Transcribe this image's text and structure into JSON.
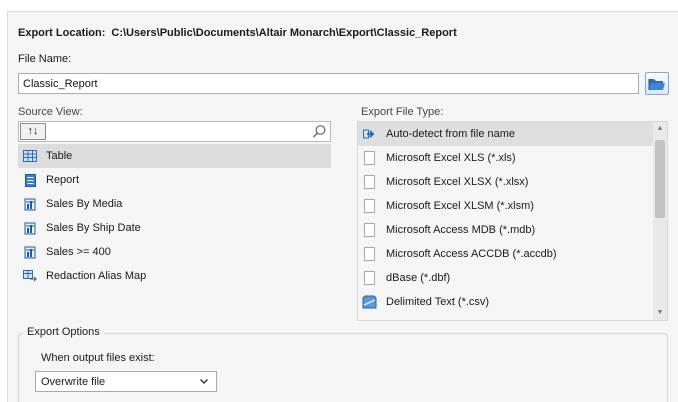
{
  "export_location": {
    "label": "Export Location:",
    "path": "C:\\Users\\Public\\Documents\\Altair Monarch\\Export\\Classic_Report"
  },
  "file_name": {
    "label": "File Name:",
    "value": "Classic_Report"
  },
  "source_view": {
    "label": "Source View:",
    "sort_button": "↑↓",
    "search_value": "",
    "items": [
      {
        "label": "Table",
        "icon": "table-icon",
        "selected": true
      },
      {
        "label": "Report",
        "icon": "report-icon",
        "selected": false
      },
      {
        "label": "Sales By Media",
        "icon": "summary-icon",
        "selected": false
      },
      {
        "label": "Sales By Ship Date",
        "icon": "summary-icon",
        "selected": false
      },
      {
        "label": "Sales >= 400",
        "icon": "summary-icon",
        "selected": false
      },
      {
        "label": "Redaction Alias Map",
        "icon": "alias-map-icon",
        "selected": false
      }
    ]
  },
  "export_file_type": {
    "label": "Export File Type:",
    "items": [
      {
        "label": "Auto-detect from file name",
        "icon": "auto-detect-icon",
        "selected": true
      },
      {
        "label": "Microsoft Excel XLS (*.xls)",
        "icon": "document-icon",
        "selected": false
      },
      {
        "label": "Microsoft Excel XLSX (*.xlsx)",
        "icon": "document-icon",
        "selected": false
      },
      {
        "label": "Microsoft Excel XLSM (*.xlsm)",
        "icon": "document-icon",
        "selected": false
      },
      {
        "label": "Microsoft Access MDB (*.mdb)",
        "icon": "document-icon",
        "selected": false
      },
      {
        "label": "Microsoft Access ACCDB (*.accdb)",
        "icon": "document-icon",
        "selected": false
      },
      {
        "label": "dBase (*.dbf)",
        "icon": "document-icon",
        "selected": false
      },
      {
        "label": "Delimited Text (*.csv)",
        "icon": "delimited-text-icon",
        "selected": false
      }
    ]
  },
  "export_options": {
    "legend": "Export Options",
    "when_exists_label": "When output files exist:",
    "when_exists_value": "Overwrite file"
  },
  "colors": {
    "selection": "#dcdcdc",
    "panel_bg": "#f5f5f5",
    "accent_blue": "#1f6fbf"
  }
}
